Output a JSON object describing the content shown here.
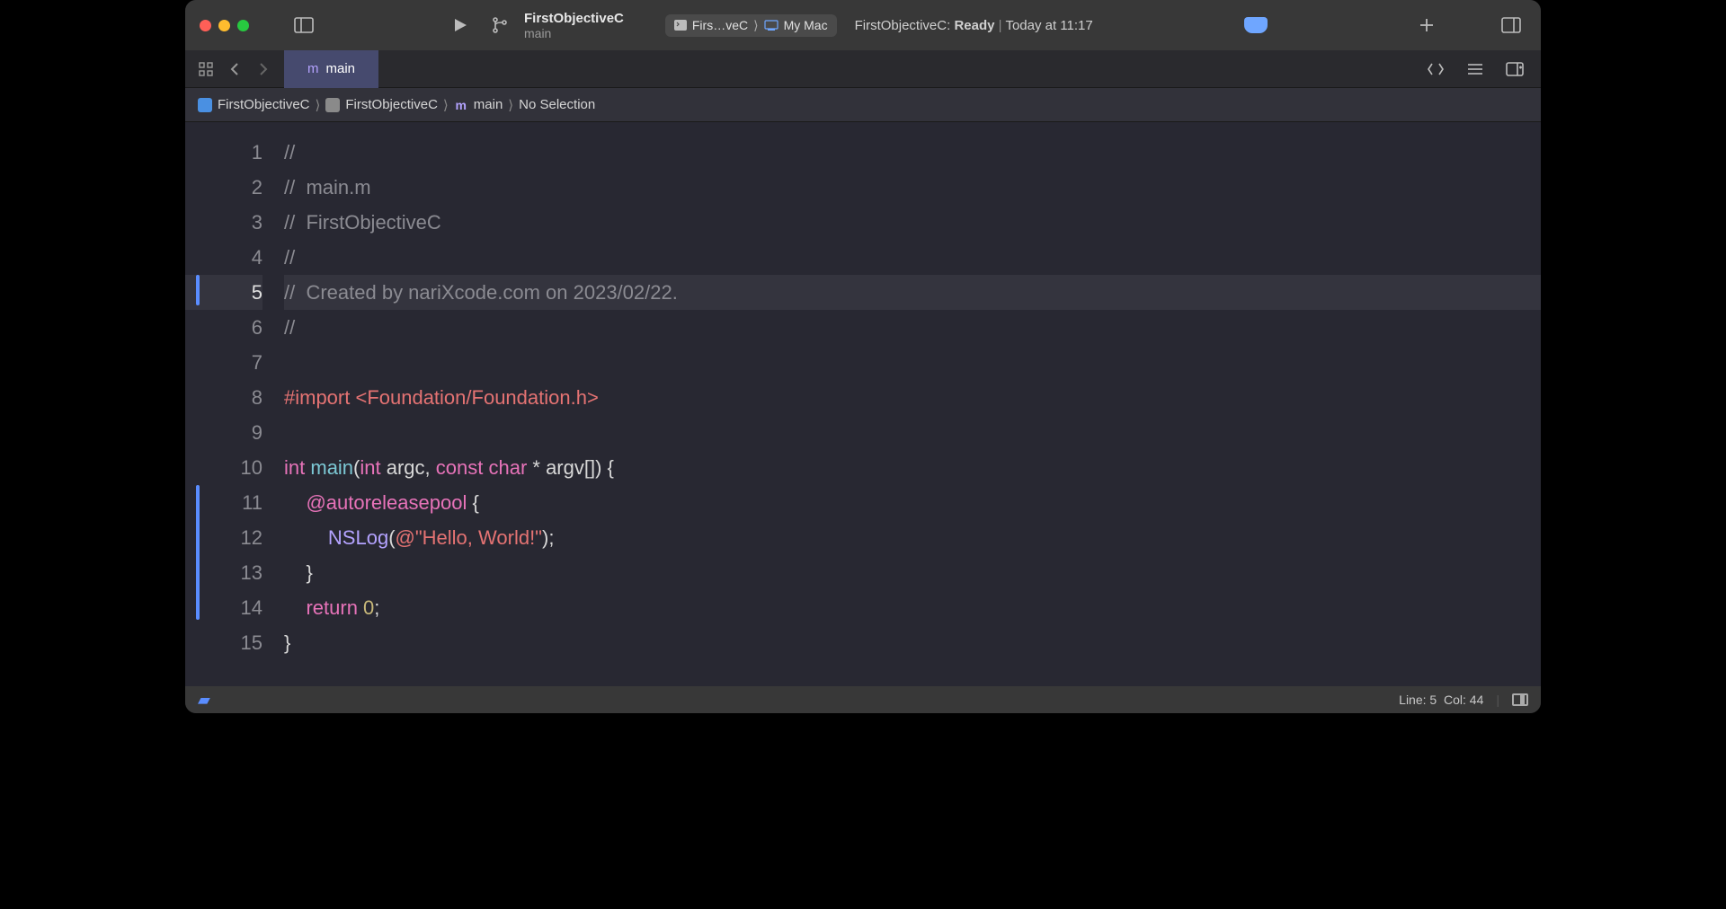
{
  "titlebar": {
    "project_name": "FirstObjectiveC",
    "branch": "main",
    "scheme_name": "Firs…veC",
    "destination": "My Mac",
    "status_prefix": "FirstObjectiveC:",
    "status_state": "Ready",
    "status_time": "Today at 11:17"
  },
  "tab": {
    "badge": "m",
    "title": "main"
  },
  "breadcrumb": {
    "items": [
      "FirstObjectiveC",
      "FirstObjectiveC",
      "main",
      "No Selection"
    ],
    "file_badge": "m"
  },
  "editor": {
    "line_numbers": [
      "1",
      "2",
      "3",
      "4",
      "5",
      "6",
      "7",
      "8",
      "9",
      "10",
      "11",
      "12",
      "13",
      "14",
      "15"
    ],
    "highlighted_line_index": 4,
    "lines": {
      "l1": "//",
      "l2": "//  main.m",
      "l3": "//  FirstObjectiveC",
      "l4": "//",
      "l5": "//  Created by nariXcode.com on 2023/02/22.",
      "l6": "//",
      "l7": "",
      "l8_import": "#import",
      "l8_header": " <Foundation/Foundation.h>",
      "l9": "",
      "l10_int": "int",
      "l10_main": " main",
      "l10_a": "(",
      "l10_int2": "int",
      "l10_argc": " argc, ",
      "l10_const": "const",
      "l10_sp": " ",
      "l10_char": "char",
      "l10_rest": " * argv[]) {",
      "l11_at": "    @autoreleasepool",
      "l11_brace": " {",
      "l12_pad": "        ",
      "l12_nslog": "NSLog",
      "l12_open": "(",
      "l12_atstr": "@\"Hello, World!\"",
      "l12_close": ");",
      "l13": "    }",
      "l14_pad": "    ",
      "l14_ret": "return",
      "l14_val": " 0",
      "l14_semi": ";",
      "l15": "}"
    }
  },
  "statusbar": {
    "line_label": "Line:",
    "line_val": "5",
    "col_label": "Col:",
    "col_val": "44"
  }
}
